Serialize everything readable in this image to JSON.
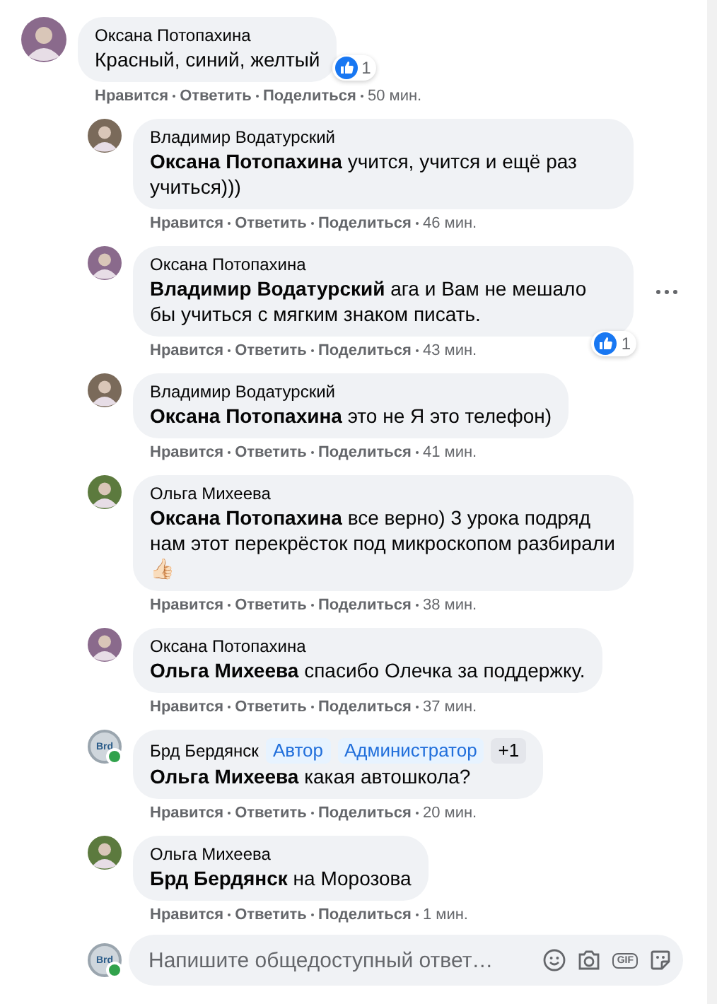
{
  "comments": [
    {
      "author": "Оксана Потопахина",
      "avatar": {
        "kind": "photo"
      },
      "text": "Красный, синий, желтый",
      "reaction": {
        "count": "1",
        "kind": "side"
      },
      "actions": [
        "Нравится",
        "Ответить",
        "Поделиться"
      ],
      "time": "50 мин.",
      "children": [
        {
          "author": "Владимир Водатурский",
          "avatar": {
            "kind": "photo"
          },
          "text": "**Оксана Потопахина** учится, учится и ещё раз учиться)))",
          "actions": [
            "Нравится",
            "Ответить",
            "Поделиться"
          ],
          "time": "46 мин."
        },
        {
          "author": "Оксана Потопахина",
          "avatar": {
            "kind": "photo"
          },
          "text": "**Владимир Водатурский** ага и Вам не мешало бы учиться с мягким знаком писать.",
          "reaction": {
            "count": "1",
            "kind": "below"
          },
          "menu": true,
          "actions": [
            "Нравится",
            "Ответить",
            "Поделиться"
          ],
          "time": "43 мин."
        },
        {
          "author": "Владимир Водатурский",
          "avatar": {
            "kind": "photo"
          },
          "text": "**Оксана Потопахина** это не Я это телефон)",
          "actions": [
            "Нравится",
            "Ответить",
            "Поделиться"
          ],
          "time": "41 мин."
        },
        {
          "author": "Ольга Михеева",
          "avatar": {
            "kind": "photo"
          },
          "text": "**Оксана Потопахина** все верно) 3 урока подряд нам этот перекрёсток под микроскопом разбирали 👍🏻",
          "actions": [
            "Нравится",
            "Ответить",
            "Поделиться"
          ],
          "time": "38 мин."
        },
        {
          "author": "Оксана Потопахина",
          "avatar": {
            "kind": "photo"
          },
          "text": "**Ольга Михеева** спасибо Олечка за поддержку.",
          "actions": [
            "Нравится",
            "Ответить",
            "Поделиться"
          ],
          "time": "37 мин."
        },
        {
          "author": "Брд Бердянск",
          "avatar": {
            "kind": "logo",
            "label": "Brd",
            "online": true
          },
          "badges": [
            {
              "label": "Автор",
              "kind": "role"
            },
            {
              "label": "Администратор",
              "kind": "role"
            },
            {
              "label": "+1",
              "kind": "more"
            }
          ],
          "text": "**Ольга Михеева** какая автошкола?",
          "actions": [
            "Нравится",
            "Ответить",
            "Поделиться"
          ],
          "time": "20 мин."
        },
        {
          "author": "Ольга Михеева",
          "avatar": {
            "kind": "photo"
          },
          "text": "**Брд Бердянск** на Морозова",
          "actions": [
            "Нравится",
            "Ответить",
            "Поделиться"
          ],
          "time": "1 мин."
        }
      ]
    }
  ],
  "reply_box": {
    "avatar": {
      "kind": "logo",
      "label": "Brd",
      "online": true
    },
    "placeholder": "Напишите общедоступный ответ…",
    "gif_label": "GIF"
  }
}
